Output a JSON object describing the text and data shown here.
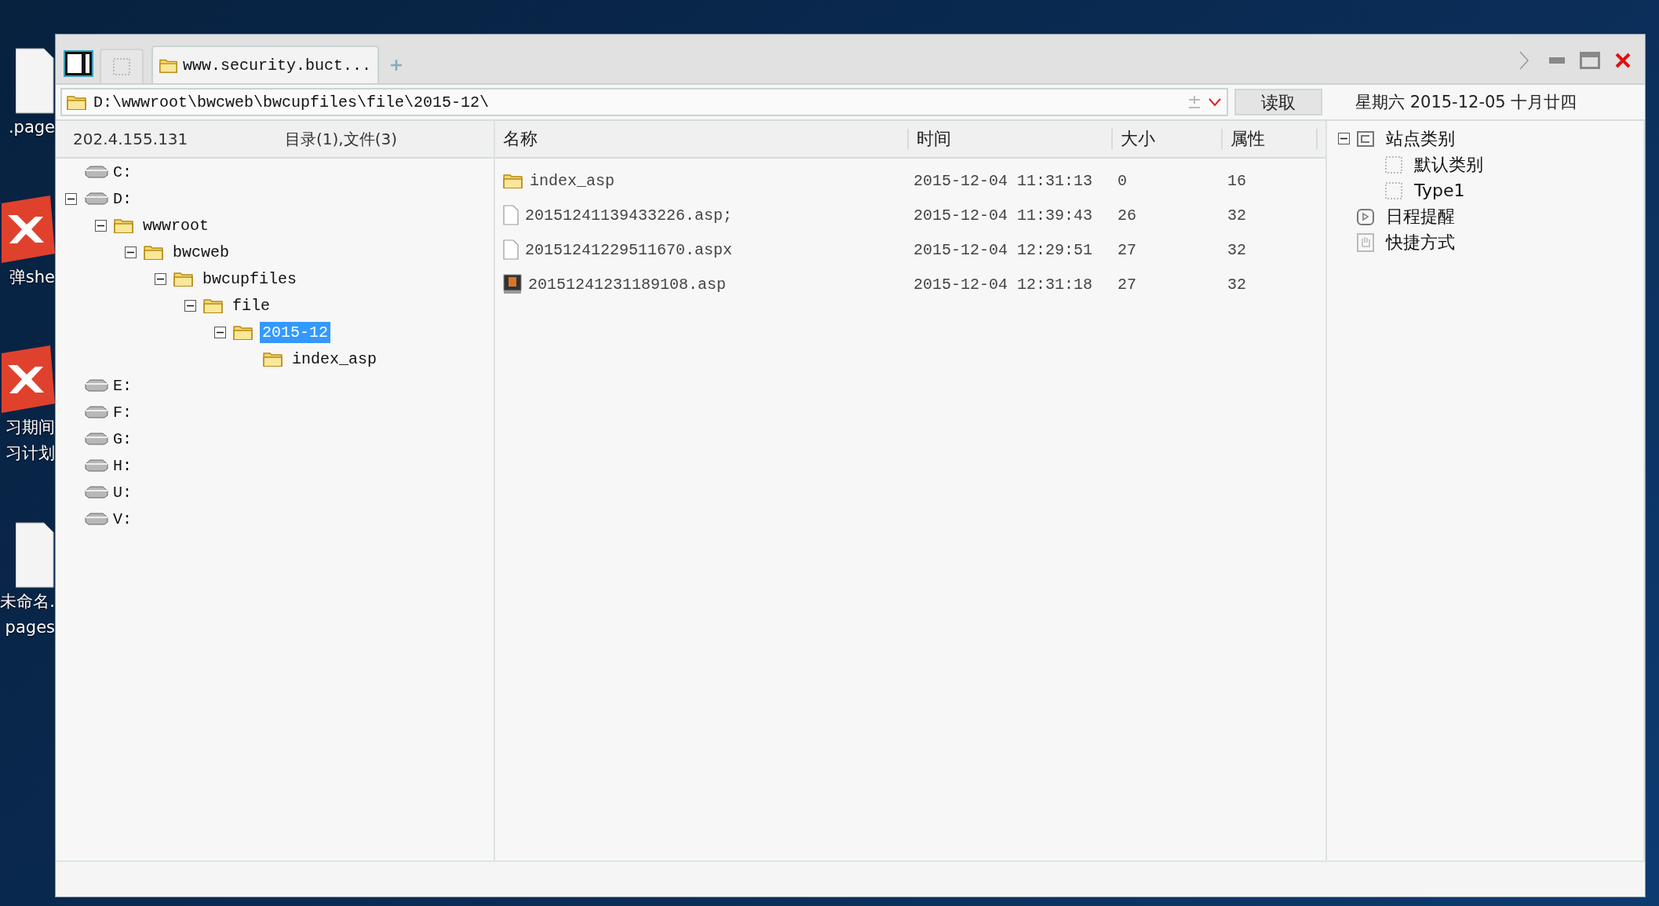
{
  "desktop_icons": [
    {
      "kind": "document",
      "lines": [
        ".page"
      ]
    },
    {
      "kind": "xmind",
      "lines": [
        "弹she"
      ]
    },
    {
      "kind": "xmind",
      "lines": [
        "习期间",
        "习计划"
      ]
    },
    {
      "kind": "document",
      "lines": [
        "未命名.",
        "pages"
      ]
    }
  ],
  "tabs": [
    {
      "label": "www.security.buct...",
      "selected": true
    }
  ],
  "address": {
    "value": "D:\\wwwroot\\bwcweb\\bwcupfiles\\file\\2015-12\\",
    "button": "读取"
  },
  "date": "星期六 2015-12-05 十月廿四",
  "left_panel": {
    "host": "202.4.155.131",
    "summary": "目录(1),文件(3)",
    "tree": [
      {
        "kind": "drive",
        "label": "C:",
        "selected": false
      },
      {
        "kind": "drive",
        "label": "D:",
        "selected": false,
        "expanded": true,
        "children": [
          {
            "kind": "folder",
            "label": "wwwroot",
            "selected": false,
            "expanded": true,
            "children": [
              {
                "kind": "folder",
                "label": "bwcweb",
                "selected": false,
                "expanded": true,
                "children": [
                  {
                    "kind": "folder",
                    "label": "bwcupfiles",
                    "selected": false,
                    "expanded": true,
                    "children": [
                      {
                        "kind": "folder",
                        "label": "file",
                        "selected": false,
                        "expanded": true,
                        "children": [
                          {
                            "kind": "folder",
                            "label": "2015-12",
                            "selected": true,
                            "expanded": true,
                            "children": [
                              {
                                "kind": "folder",
                                "label": "index_asp",
                                "selected": false
                              }
                            ]
                          }
                        ]
                      }
                    ]
                  }
                ]
              }
            ]
          }
        ]
      },
      {
        "kind": "drive",
        "label": "E:",
        "selected": false
      },
      {
        "kind": "drive",
        "label": "F:",
        "selected": false
      },
      {
        "kind": "drive",
        "label": "G:",
        "selected": false
      },
      {
        "kind": "drive",
        "label": "H:",
        "selected": false
      },
      {
        "kind": "drive",
        "label": "U:",
        "selected": false
      },
      {
        "kind": "drive",
        "label": "V:",
        "selected": false
      }
    ]
  },
  "file_list": {
    "columns": [
      "名称",
      "时间",
      "大小",
      "属性"
    ],
    "rows": [
      {
        "kind": "folder",
        "name": "index_asp",
        "time": "2015-12-04 11:31:13",
        "size": "0",
        "attr": "16"
      },
      {
        "kind": "file",
        "name": "20151241139433226.asp;",
        "time": "2015-12-04 11:39:43",
        "size": "26",
        "attr": "32"
      },
      {
        "kind": "file",
        "name": "20151241229511670.aspx",
        "time": "2015-12-04 12:29:51",
        "size": "27",
        "attr": "32"
      },
      {
        "kind": "script",
        "name": "20151241231189108.asp",
        "time": "2015-12-04 12:31:18",
        "size": "27",
        "attr": "32"
      }
    ]
  },
  "right_panel": {
    "tree": [
      {
        "kind": "category",
        "label": "站点类别",
        "expanded": true,
        "children": [
          {
            "kind": "item",
            "label": "默认类别"
          },
          {
            "kind": "item",
            "label": "Type1"
          }
        ]
      },
      {
        "kind": "schedule",
        "label": "日程提醒"
      },
      {
        "kind": "shortcut",
        "label": "快捷方式"
      }
    ]
  }
}
